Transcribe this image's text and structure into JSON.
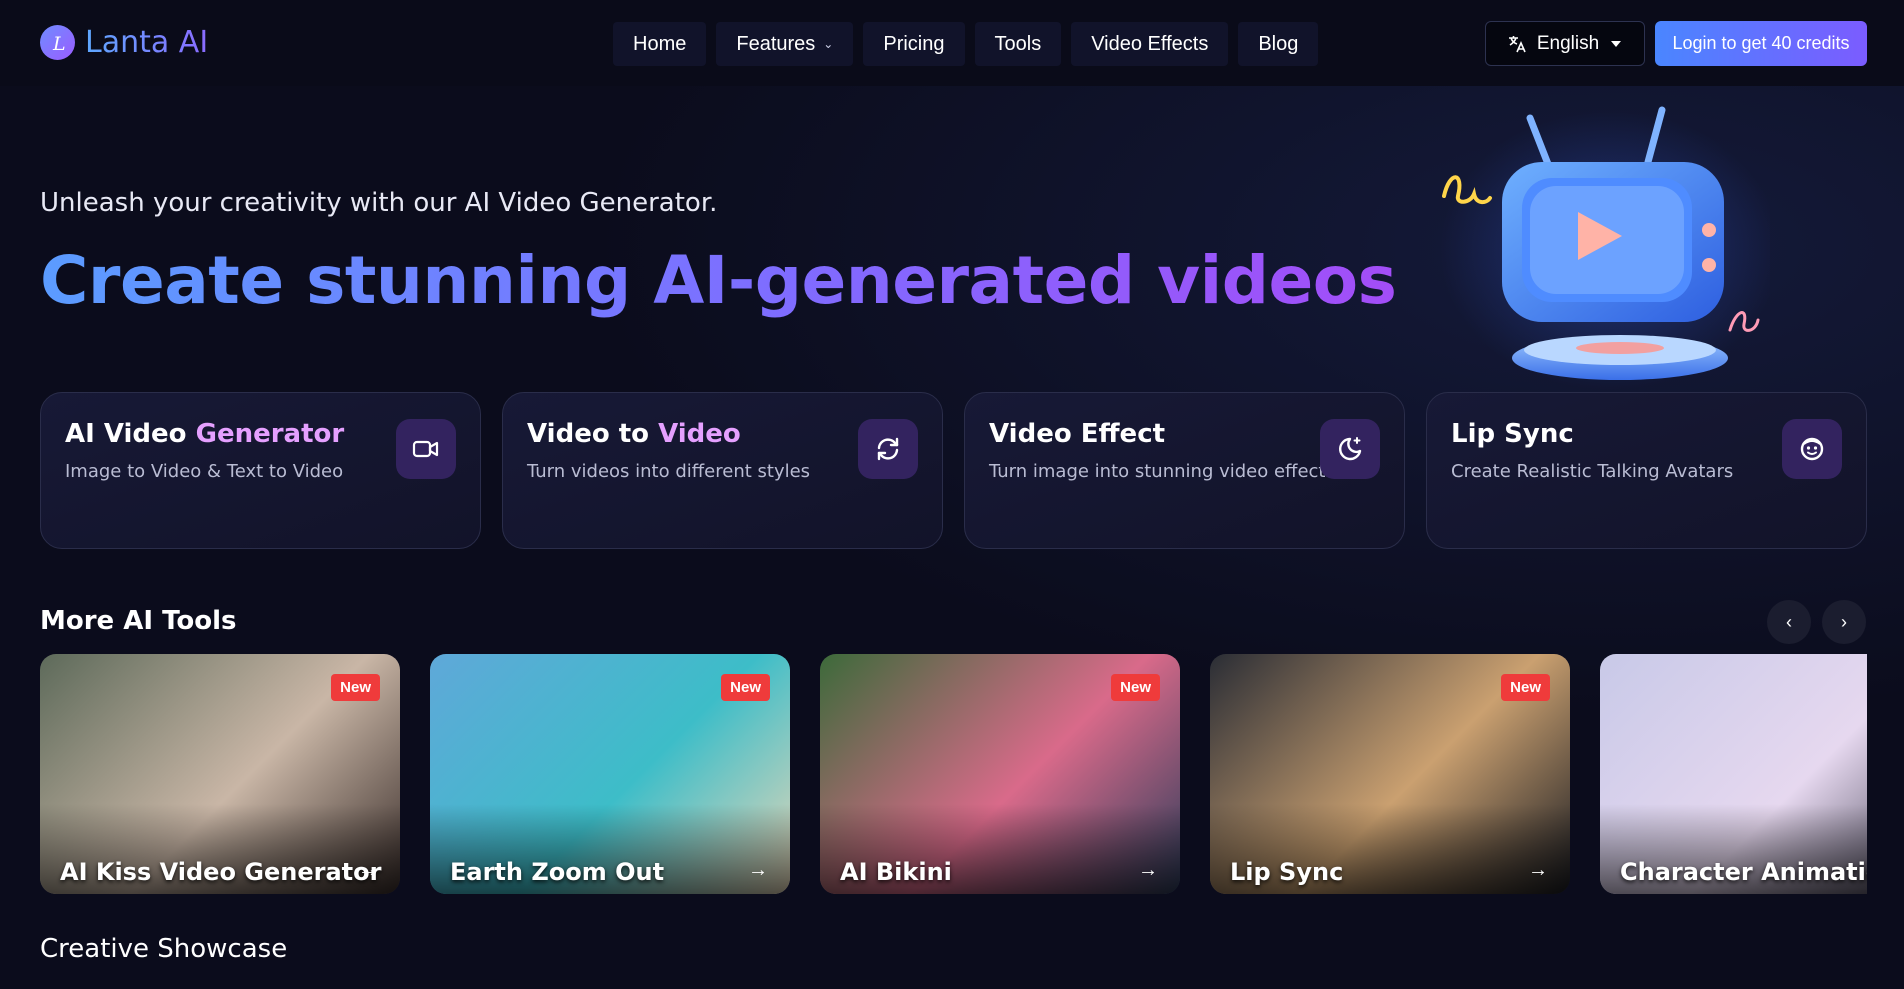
{
  "brand": {
    "name": "Lanta AI",
    "logo_letter": "L"
  },
  "nav": {
    "items": [
      {
        "label": "Home"
      },
      {
        "label": "Features",
        "has_dropdown": true
      },
      {
        "label": "Pricing"
      },
      {
        "label": "Tools"
      },
      {
        "label": "Video Effects"
      },
      {
        "label": "Blog"
      }
    ]
  },
  "header": {
    "language": {
      "label": "English",
      "icon": "translate-icon"
    },
    "login_label": "Login to get 40 credits"
  },
  "hero": {
    "tagline": "Unleash your creativity with our AI Video Generator.",
    "title": "Create stunning AI-generated videos"
  },
  "features": [
    {
      "title": "AI Video",
      "title_accent": "Generator",
      "subtitle": "Image to Video & Text to Video",
      "icon": "video-camera-icon"
    },
    {
      "title": "Video to",
      "title_accent": "Video",
      "subtitle": "Turn videos into different styles",
      "icon": "refresh-icon"
    },
    {
      "title": "Video Effect",
      "title_accent": "",
      "subtitle": "Turn image into stunning video effects",
      "icon": "moon-sparkle-icon"
    },
    {
      "title": "Lip Sync",
      "title_accent": "",
      "subtitle": "Create Realistic Talking Avatars",
      "icon": "smiley-face-icon"
    }
  ],
  "more_tools": {
    "title": "More AI Tools",
    "cards": [
      {
        "label": "AI Kiss Video Generator",
        "badge": "New",
        "colors": [
          "#5d6a5a",
          "#c9b6a6",
          "#3a2e2b"
        ]
      },
      {
        "label": "Earth Zoom Out",
        "badge": "New",
        "colors": [
          "#5fa8d9",
          "#3dbdc8",
          "#e8d7b8"
        ]
      },
      {
        "label": "AI Bikini",
        "badge": "New",
        "colors": [
          "#3c6a3a",
          "#d96a8a",
          "#2c3c5a"
        ]
      },
      {
        "label": "Lip Sync",
        "badge": "New",
        "colors": [
          "#2a2d35",
          "#caa070",
          "#1a1c22"
        ]
      },
      {
        "label": "Character Animation",
        "badge": "",
        "colors": [
          "#c8c9e8",
          "#e6d8ef",
          "#2a2a3a"
        ]
      }
    ]
  },
  "showcase": {
    "title": "Creative Showcase"
  },
  "colors": {
    "background": "#0b0c1c",
    "accent_blue": "#4a86ff",
    "accent_purple": "#7b5cff",
    "badge_red": "#ef3b3b",
    "feature_accent": "#e5a0ff"
  }
}
